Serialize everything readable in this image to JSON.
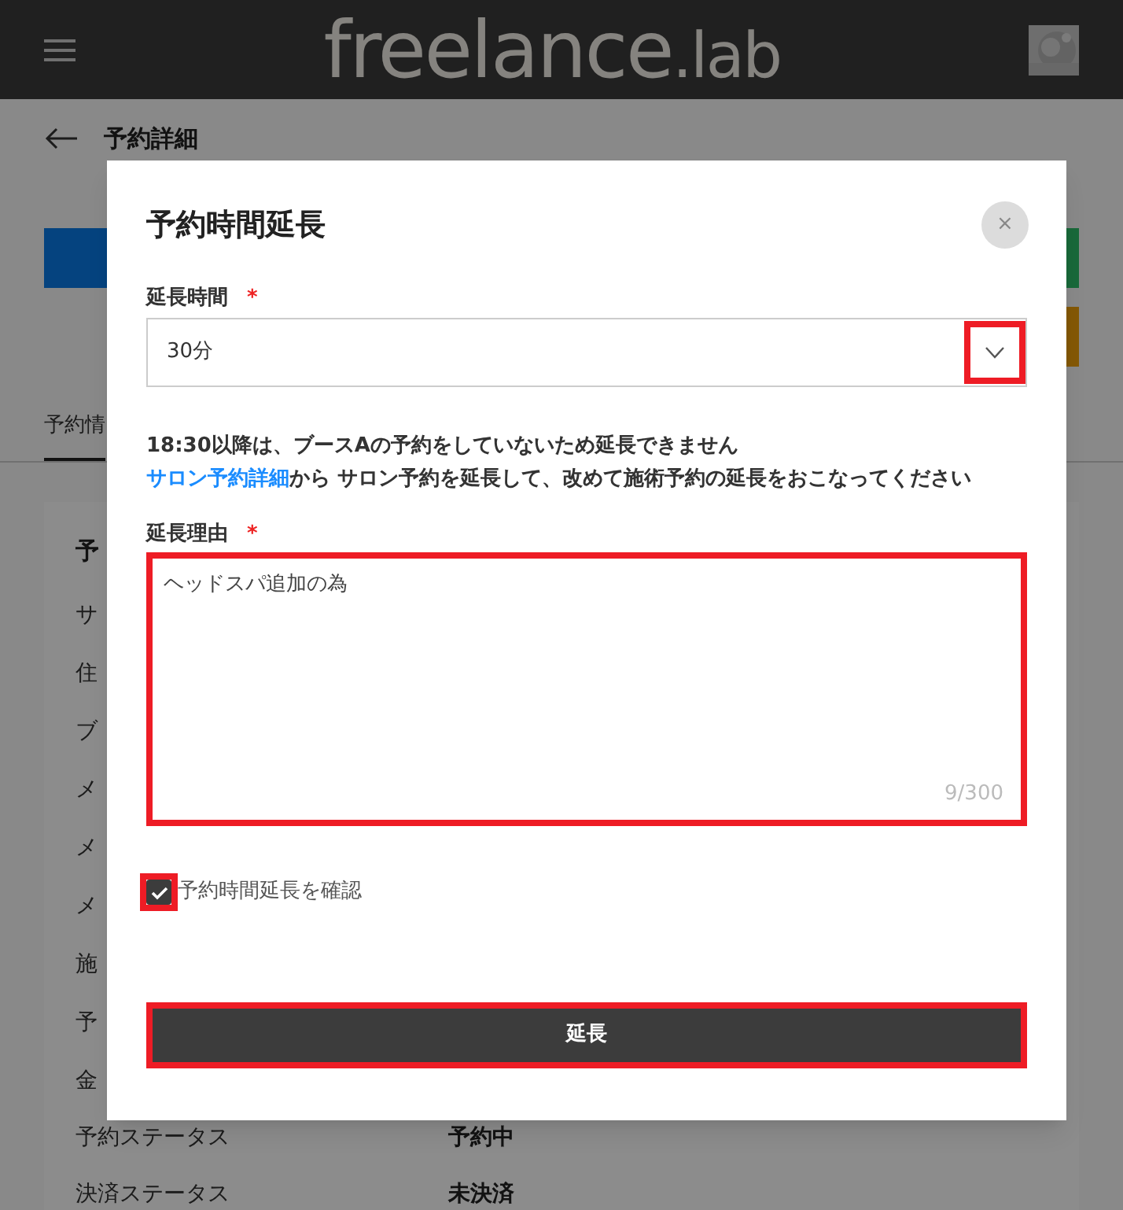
{
  "header": {
    "logo_main": "freelance",
    "logo_suffix": ".lab"
  },
  "page": {
    "title": "予約詳細",
    "tab": "予約情",
    "card_title": "予",
    "rows": [
      {
        "label": "サ"
      },
      {
        "label": "住"
      },
      {
        "label": "ブ"
      },
      {
        "label": "メ"
      },
      {
        "label": "メ"
      },
      {
        "label": "メ"
      },
      {
        "label": "施"
      },
      {
        "label": "予"
      },
      {
        "label": "金"
      }
    ],
    "status_rows": [
      {
        "label": "予約ステータス",
        "value": "予約中"
      },
      {
        "label": "決済ステータス",
        "value": "未決済"
      }
    ]
  },
  "dialog": {
    "title": "予約時間延長",
    "close": "×",
    "duration": {
      "label": "延長時間",
      "required": "*",
      "value": "30分",
      "highlighted": true
    },
    "notice": "18:30以降は、ブースAの予約をしていないため延長できません",
    "link": "サロン予約詳細",
    "notice_rest": "から サロン予約を延長して、改めて施術予約の延長をおこなってください",
    "reason": {
      "label": "延長理由",
      "required": "*",
      "value": "ヘッドスパ追加の為",
      "counter": "9/300",
      "highlighted": true
    },
    "confirm": {
      "label": "予約時間延長を確認",
      "checked": true,
      "highlighted": true
    },
    "submit": {
      "label": "延長",
      "highlighted": true
    }
  }
}
